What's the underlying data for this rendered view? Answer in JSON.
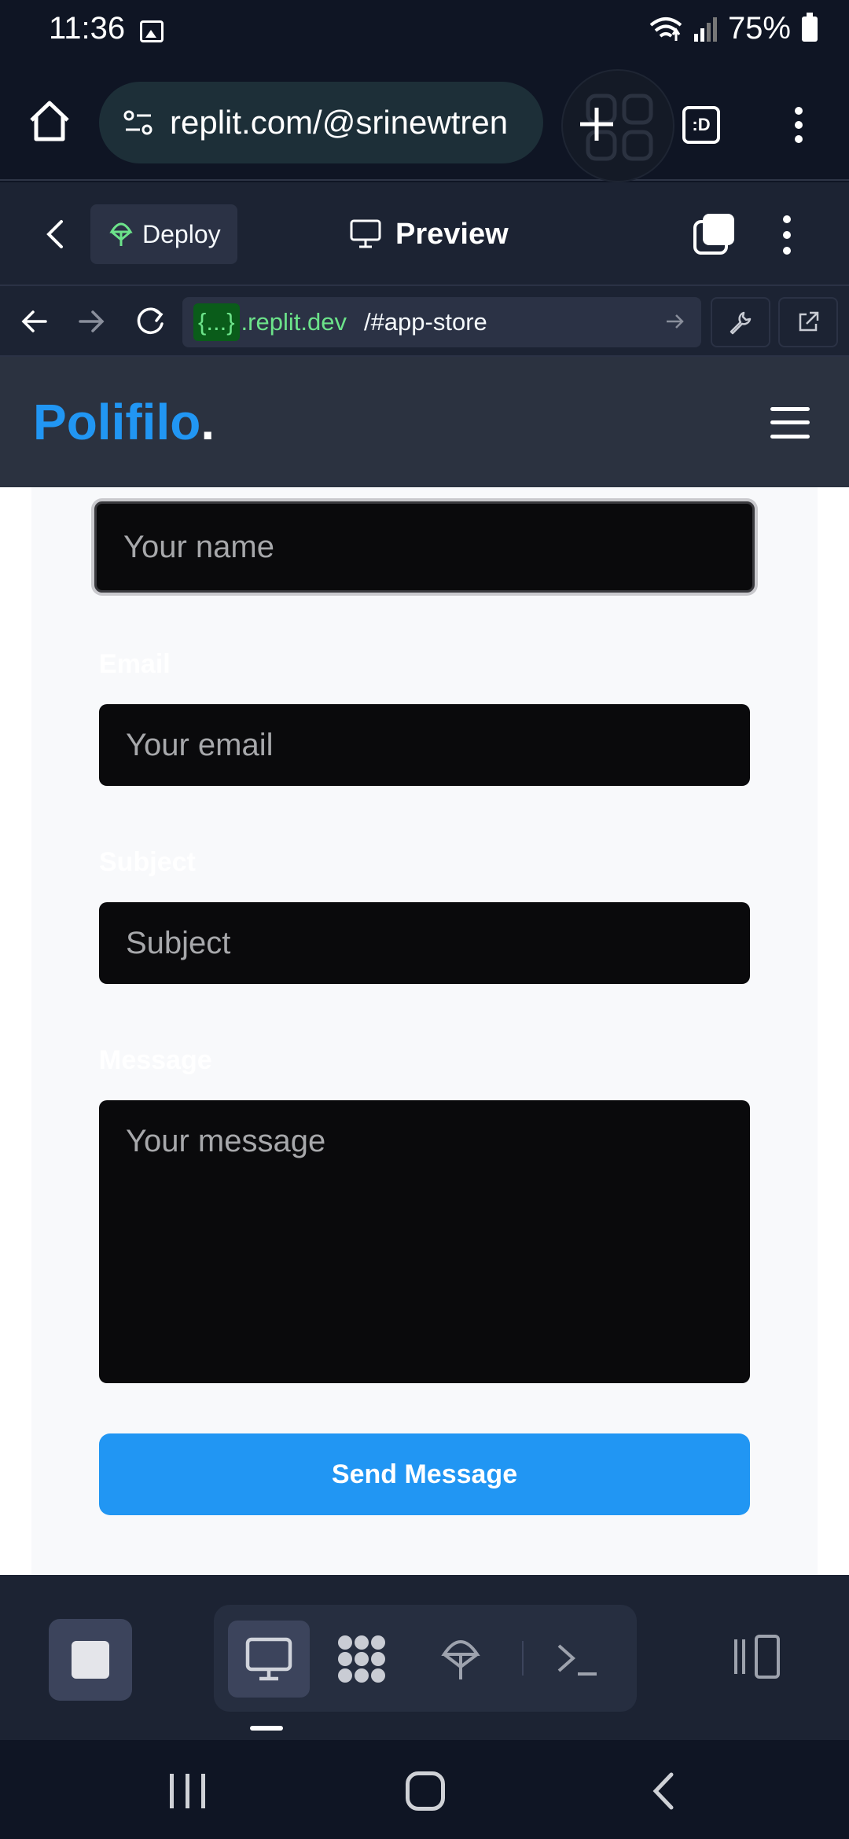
{
  "status_bar": {
    "time": "11:36",
    "battery": "75%",
    "icons": [
      "image-notification-icon",
      "wifi-icon",
      "signal-icon",
      "battery-icon"
    ]
  },
  "browser": {
    "url": "replit.com/@srinewtren",
    "tab_count": ":D",
    "icons": [
      "home-icon",
      "site-settings-icon",
      "new-tab-icon",
      "tab-switcher-icon",
      "more-vert-icon"
    ]
  },
  "replit_header": {
    "deploy_label": "Deploy",
    "preview_label": "Preview"
  },
  "webview": {
    "url_badge": "{...}",
    "url_domain": ".replit.dev",
    "url_path": "/#app-store"
  },
  "site": {
    "logo_text": "Polifilo",
    "logo_dot": ".",
    "accent_color": "#2196f3"
  },
  "form": {
    "name_placeholder": "Your name",
    "email_label": "Email",
    "email_placeholder": "Your email",
    "subject_label": "Subject",
    "subject_placeholder": "Subject",
    "message_label": "Message",
    "message_placeholder": "Your message",
    "submit_label": "Send Message"
  },
  "toolbar": {
    "items": [
      "stop-icon",
      "preview-desktop-icon",
      "agent-icon",
      "deploy-icon",
      "terminal-icon",
      "panel-toggle-icon"
    ]
  }
}
